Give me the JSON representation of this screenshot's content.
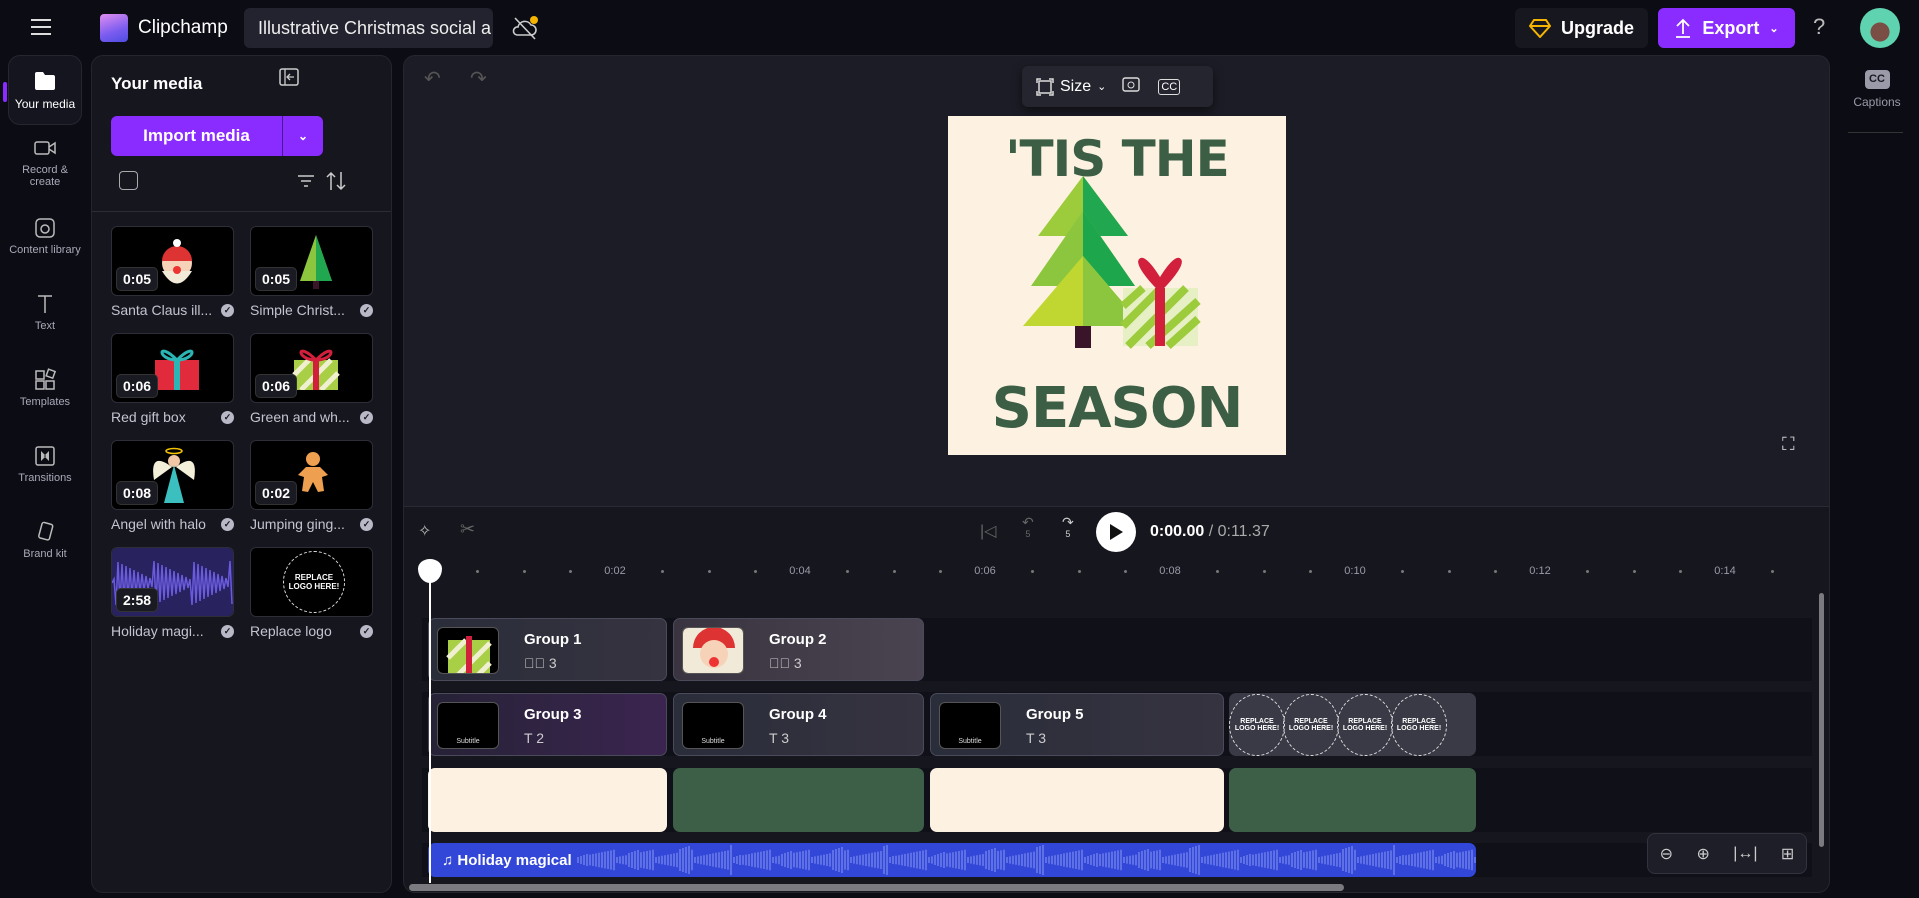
{
  "app": {
    "name": "Clipchamp",
    "project_title": "Illustrative Christmas social a",
    "upgrade": "Upgrade",
    "export": "Export",
    "help": "?"
  },
  "nav": [
    {
      "label": "Your media"
    },
    {
      "label": "Record & create"
    },
    {
      "label": "Content library"
    },
    {
      "label": "Text"
    },
    {
      "label": "Templates"
    },
    {
      "label": "Transitions"
    },
    {
      "label": "Brand kit"
    }
  ],
  "media": {
    "title": "Your media",
    "import": "Import media",
    "items": [
      {
        "name": "Santa Claus ill...",
        "duration": "0:05"
      },
      {
        "name": "Simple Christ...",
        "duration": "0:05"
      },
      {
        "name": "Red gift box",
        "duration": "0:06"
      },
      {
        "name": "Green and wh...",
        "duration": "0:06"
      },
      {
        "name": "Angel with halo",
        "duration": "0:08"
      },
      {
        "name": "Jumping ging...",
        "duration": "0:02"
      },
      {
        "name": "Holiday magi...",
        "duration": "2:58"
      },
      {
        "name": "Replace logo",
        "duration": ""
      }
    ],
    "logo_text": "REPLACE LOGO HERE!"
  },
  "preview": {
    "size": "Size",
    "line1": "'TIS THE",
    "line2": "SEASON"
  },
  "playback": {
    "current": "0:00.00",
    "total": "/ 0:11.37",
    "skip5": "5"
  },
  "ruler": [
    "0:02",
    "0:04",
    "0:06",
    "0:08",
    "0:10",
    "0:12",
    "0:14"
  ],
  "timeline": {
    "groups": [
      {
        "title": "Group 1",
        "count": "3"
      },
      {
        "title": "Group 2",
        "count": "3"
      },
      {
        "title": "Group 3",
        "count": "2"
      },
      {
        "title": "Group 4",
        "count": "3"
      },
      {
        "title": "Group 5",
        "count": "3"
      }
    ],
    "subtitle": "Subtitle",
    "audio": "Holiday magical",
    "logo": "REPLACE LOGO HERE!"
  },
  "right": {
    "captions": "Captions",
    "cc": "CC"
  }
}
